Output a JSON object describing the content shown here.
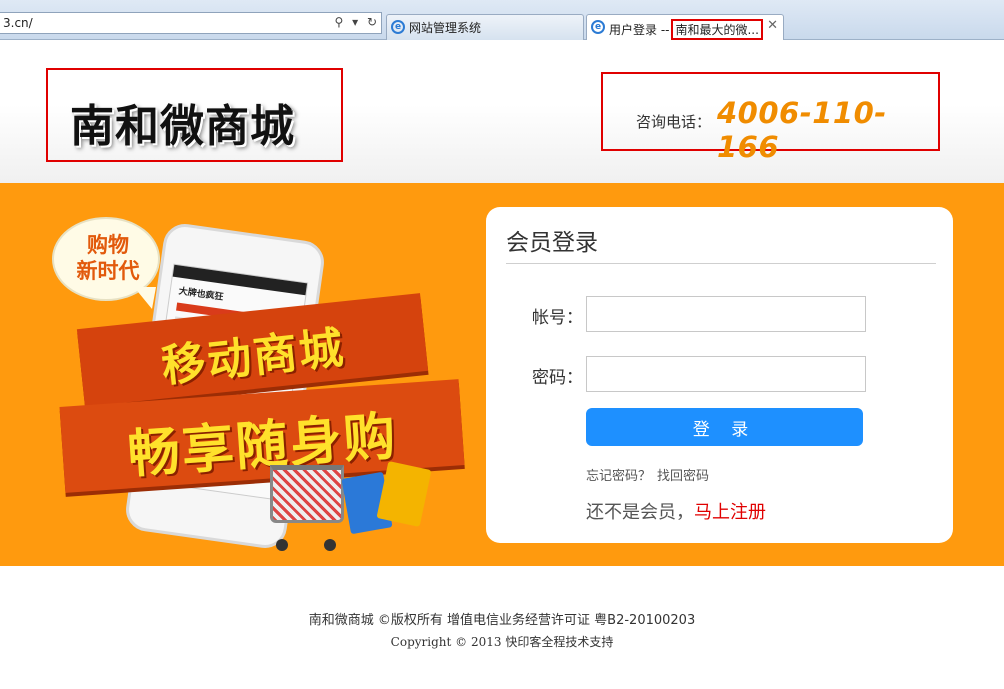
{
  "browser": {
    "address_text": "3.cn/",
    "tabs": [
      {
        "label": "网站管理系统",
        "active": false
      },
      {
        "label_prefix": "用户登录 --",
        "label_highlight": "南和最大的微...",
        "active": true
      }
    ],
    "icons": [
      "search-icon",
      "dropdown-icon",
      "refresh-icon",
      "ie-icon",
      "close-icon"
    ]
  },
  "header": {
    "logo_text": "南和微商城",
    "phone_label": "咨询电话：",
    "phone_number": "4006-110-166"
  },
  "promo": {
    "bubble_line1": "购物",
    "bubble_line2": "新时代",
    "ribbon1": "移动商城",
    "ribbon2": "畅享随身购",
    "phone_screen_text": "大牌也疯狂",
    "colors": {
      "banner": "#ff9a0e",
      "ribbon": "#d5430d",
      "ribbon_text": "#ffe12b"
    }
  },
  "login": {
    "title": "会员登录",
    "account_label": "帐号：",
    "password_label": "密码：",
    "account_value": "",
    "password_value": "",
    "submit_label": "登 录",
    "forgot_text": "忘记密码？",
    "retrieve_link": "找回密码",
    "register_prompt": "还不是会员，",
    "register_link": "马上注册",
    "colors": {
      "button": "#1e90ff",
      "register_link": "#e00000"
    }
  },
  "footer": {
    "line1": "南和微商城 ©版权所有 增值电信业务经营许可证 粤B2-20100203",
    "line2": "Copyright © 2013 快印客全程技术支持"
  }
}
